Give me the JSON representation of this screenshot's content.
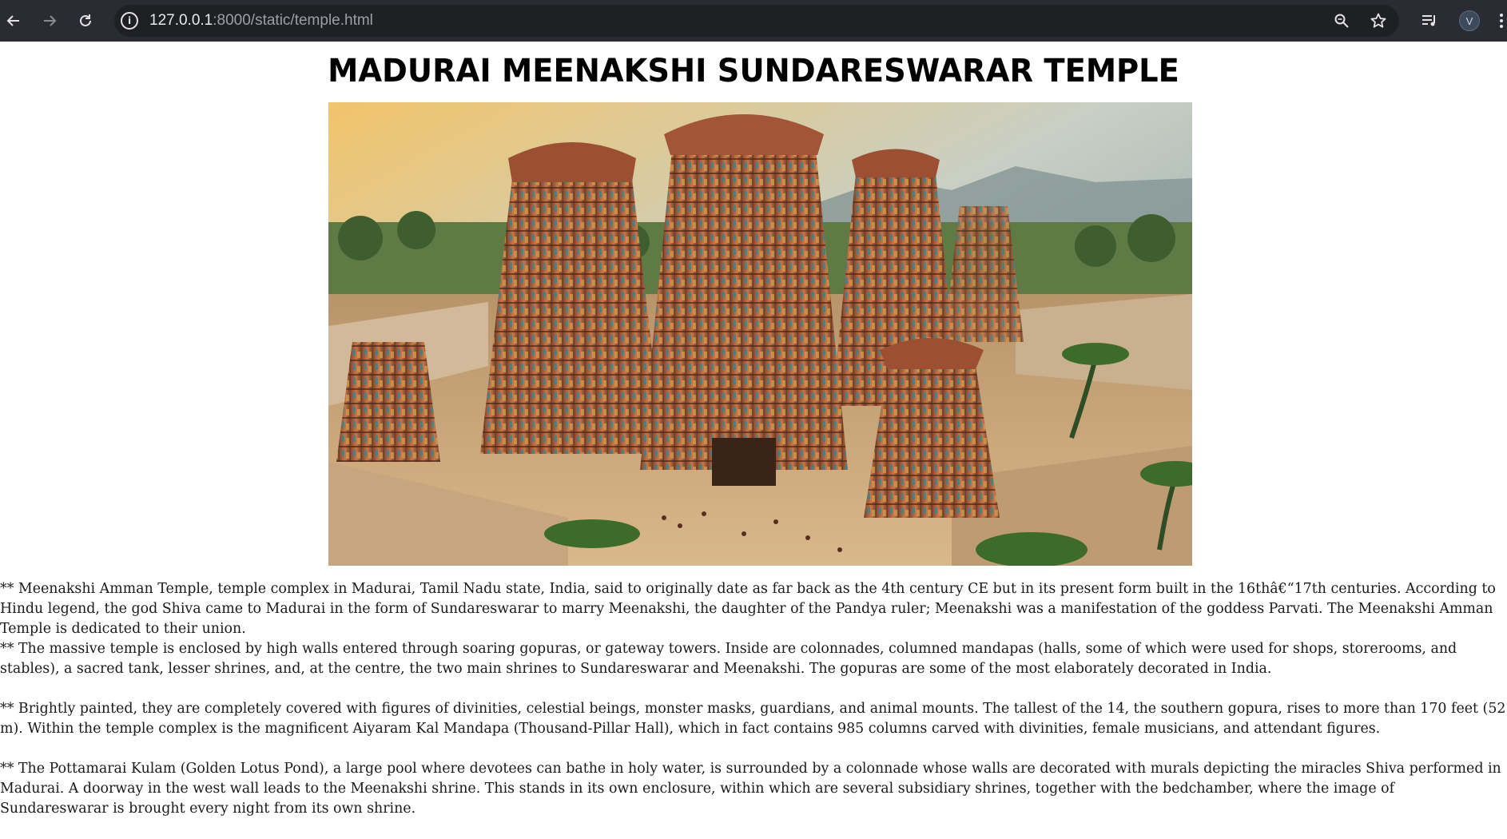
{
  "browser": {
    "url_host": "127.0.0.1",
    "url_rest": ":8000/static/temple.html",
    "profile_initial": "V",
    "icons": [
      "back-arrow-icon",
      "forward-arrow-icon",
      "reload-icon",
      "site-info-icon",
      "zoom-icon",
      "bookmark-star-icon",
      "media-controls-icon",
      "menu-kebab-icon"
    ]
  },
  "page": {
    "title": "MADURAI MEENAKSHI SUNDARESWARAR TEMPLE",
    "paragraphs": [
      "** Meenakshi Amman Temple, temple complex in Madurai, Tamil Nadu state, India, said to originally date as far back as the 4th century CE but in its present form built in the 16thâ€“17th centuries. According to Hindu legend, the god Shiva came to Madurai in the form of Sundareswarar to marry Meenakshi, the daughter of the Pandya ruler; Meenakshi was a manifestation of the goddess Parvati. The Meenakshi Amman Temple is dedicated to their union.",
      "** The massive temple is enclosed by high walls entered through soaring gopuras, or gateway towers. Inside are colonnades, columned mandapas (halls, some of which were used for shops, storerooms, and stables), a sacred tank, lesser shrines, and, at the centre, the two main shrines to Sundareswarar and Meenakshi. The gopuras are some of the most elaborately decorated in India.",
      "** Brightly painted, they are completely covered with figures of divinities, celestial beings, monster masks, guardians, and animal mounts. The tallest of the 14, the southern gopura, rises to more than 170 feet (52 m). Within the temple complex is the magnificent Aiyaram Kal Mandapa (Thousand-Pillar Hall), which in fact contains 985 columns carved with divinities, female musicians, and attendant figures.",
      "** The Pottamarai Kulam (Golden Lotus Pond), a large pool where devotees can bathe in holy water, is surrounded by a colonnade whose walls are decorated with murals depicting the miracles Shiva performed in Madurai. A doorway in the west wall leads to the Meenakshi shrine. This stands in its own enclosure, within which are several subsidiary shrines, together with the bedchamber, where the image of Sundareswarar is brought every night from its own shrine."
    ]
  },
  "colors": {
    "chrome_bg": "#2b2c33",
    "omnibox_bg": "#1f2024",
    "page_bg": "#ffffff",
    "text": "#1a1a1a"
  }
}
